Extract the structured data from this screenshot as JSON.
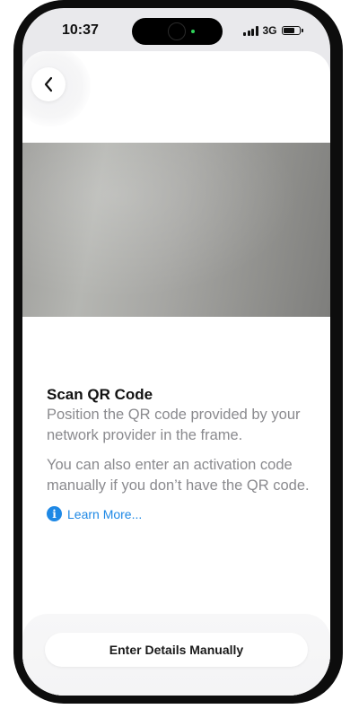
{
  "status_bar": {
    "time": "10:37",
    "network": "3G",
    "icons": [
      "signal-icon",
      "battery-icon"
    ]
  },
  "header": {
    "back_icon": "chevron-left-icon"
  },
  "main": {
    "title": "Scan QR Code",
    "description": "Position the QR code provided by your network provider in the frame.",
    "secondary_description": "You can also enter an activation code manually if you don’t have the QR code.",
    "learn_more_label": "Learn More...",
    "info_icon": "i"
  },
  "footer": {
    "manual_button_label": "Enter Details Manually"
  },
  "colors": {
    "accent": "#1e88e5",
    "secondary_text": "#8a8a8e",
    "island_indicator": "#2fd35a"
  }
}
